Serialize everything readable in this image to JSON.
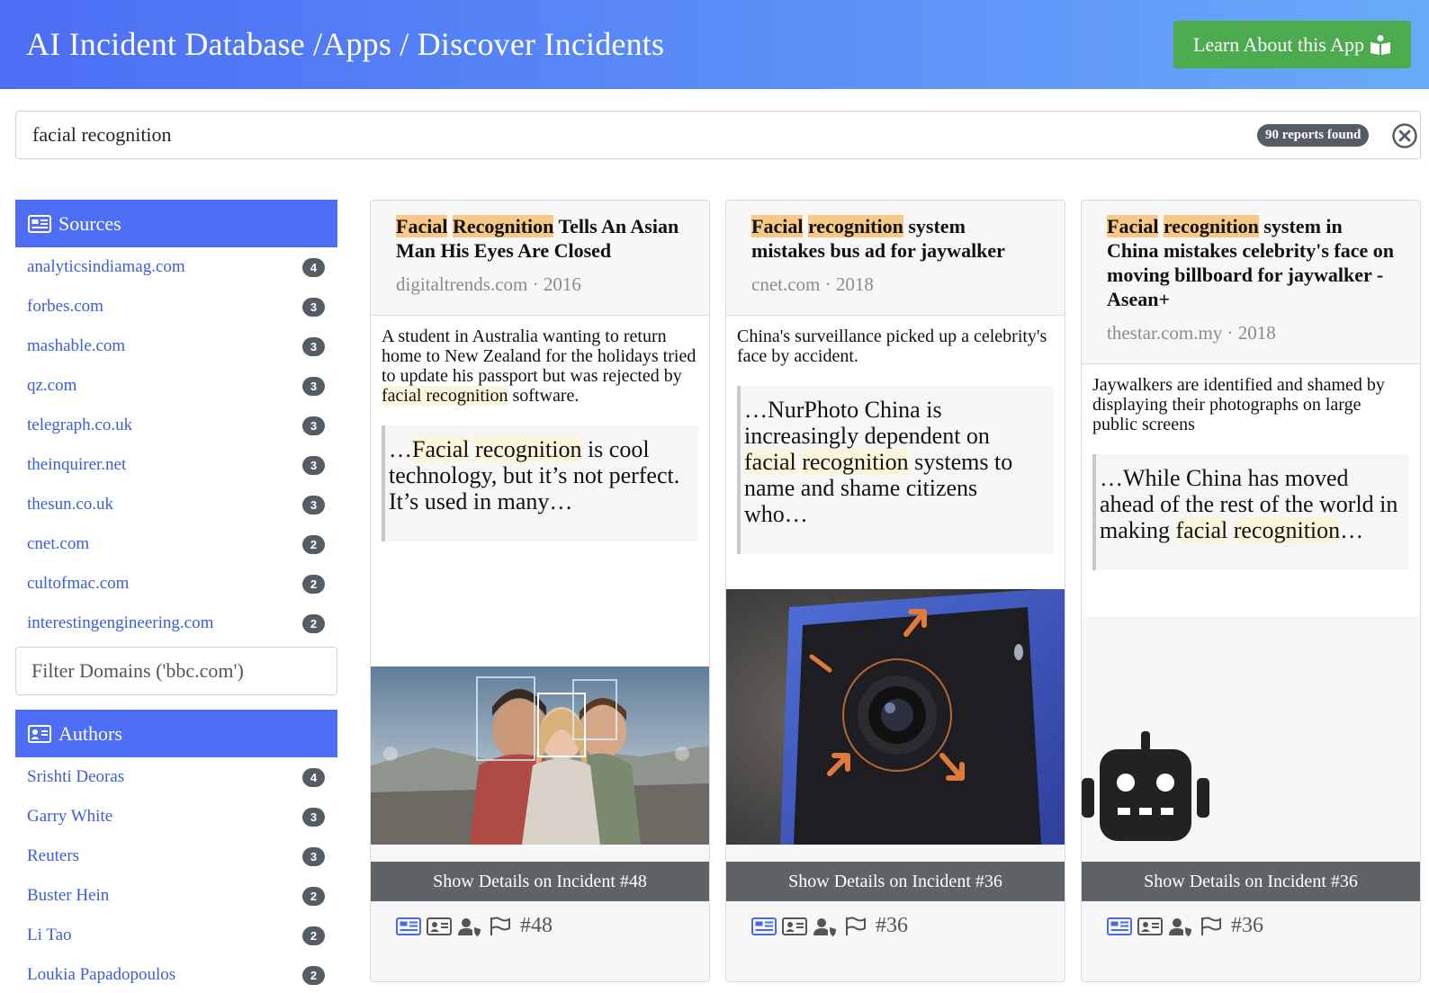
{
  "header": {
    "title": "AI Incident Database /Apps / Discover Incidents",
    "learn_button": "Learn About this App"
  },
  "search": {
    "value": "facial recognition",
    "results_badge": "90 reports found"
  },
  "sources": {
    "heading": "Sources",
    "items": [
      {
        "label": "analyticsindiamag.com",
        "count": "4"
      },
      {
        "label": "forbes.com",
        "count": "3"
      },
      {
        "label": "mashable.com",
        "count": "3"
      },
      {
        "label": "qz.com",
        "count": "3"
      },
      {
        "label": "telegraph.co.uk",
        "count": "3"
      },
      {
        "label": "theinquirer.net",
        "count": "3"
      },
      {
        "label": "thesun.co.uk",
        "count": "3"
      },
      {
        "label": "cnet.com",
        "count": "2"
      },
      {
        "label": "cultofmac.com",
        "count": "2"
      },
      {
        "label": "interestingengineering.com",
        "count": "2"
      }
    ],
    "filter_placeholder": "Filter Domains ('bbc.com')"
  },
  "authors": {
    "heading": "Authors",
    "items": [
      {
        "label": "Srishti Deoras",
        "count": "4"
      },
      {
        "label": "Garry White",
        "count": "3"
      },
      {
        "label": "Reuters",
        "count": "3"
      },
      {
        "label": "Buster Hein",
        "count": "2"
      },
      {
        "label": "Li Tao",
        "count": "2"
      },
      {
        "label": "Loukia Papadopoulos",
        "count": "2"
      }
    ]
  },
  "cards": [
    {
      "title_hl1": "Facial",
      "title_gap1": " ",
      "title_hl2": "Recognition",
      "title_rest": " Tells An Asian Man His Eyes Are Closed",
      "meta": "digitaltrends.com · 2016",
      "desc_a": "A student in Australia wanting to return home to New Zealand for the holidays tried to update his passport but was rejected by ",
      "desc_hl": "facial recognition",
      "desc_b": " software.",
      "quote_a": "…",
      "quote_hl1": "Facial",
      "quote_gap": " ",
      "quote_hl2": "recognition",
      "quote_b": " is cool technology, but it’s not perfect. It’s used in many…",
      "details": "Show Details on Incident #48",
      "incident_number": "#48"
    },
    {
      "title_hl1": "Facial",
      "title_gap1": " ",
      "title_hl2": "recognition",
      "title_rest": " system mistakes bus ad for jaywalker",
      "meta": "cnet.com · 2018",
      "desc_a": "China's surveillance picked up a celebrity's face by accident.",
      "desc_hl": "",
      "desc_b": "",
      "quote_a": "…NurPhoto China is increasingly dependent on ",
      "quote_hl1": "facial",
      "quote_gap": " ",
      "quote_hl2": "recognition",
      "quote_b": " systems to name and shame citizens who…",
      "details": "Show Details on Incident #36",
      "incident_number": "#36"
    },
    {
      "title_hl1": "Facial",
      "title_gap1": " ",
      "title_hl2": "recognition",
      "title_rest": " system in China mistakes celebrity's face on moving billboard for jaywalker - Asean+",
      "meta": "thestar.com.my · 2018",
      "desc_a": "Jaywalkers are identified and shamed by displaying their photographs on large public screens",
      "desc_hl": "",
      "desc_b": "",
      "quote_a": "…While China has moved ahead of the rest of the world in making ",
      "quote_hl1": "facial",
      "quote_gap": " ",
      "quote_hl2": "recognition",
      "quote_b": "…",
      "details": "Show Details on Incident #36",
      "incident_number": "#36"
    }
  ],
  "colors": {
    "header_start": "#4c6ef5",
    "header_end": "#69aaf8",
    "learn_button": "#4caa4f",
    "panel_heading": "#4d6ef4",
    "link": "#3a5ed8",
    "badge": "#555c63",
    "highlight": "#f6c987",
    "highlight_soft": "#fbf5dc",
    "details_button": "#5f6367"
  },
  "icons": [
    "book-reader-icon",
    "clear-circle-icon",
    "newspaper-icon",
    "id-card-icon",
    "user-shield-icon",
    "flag-icon",
    "robot-icon"
  ]
}
